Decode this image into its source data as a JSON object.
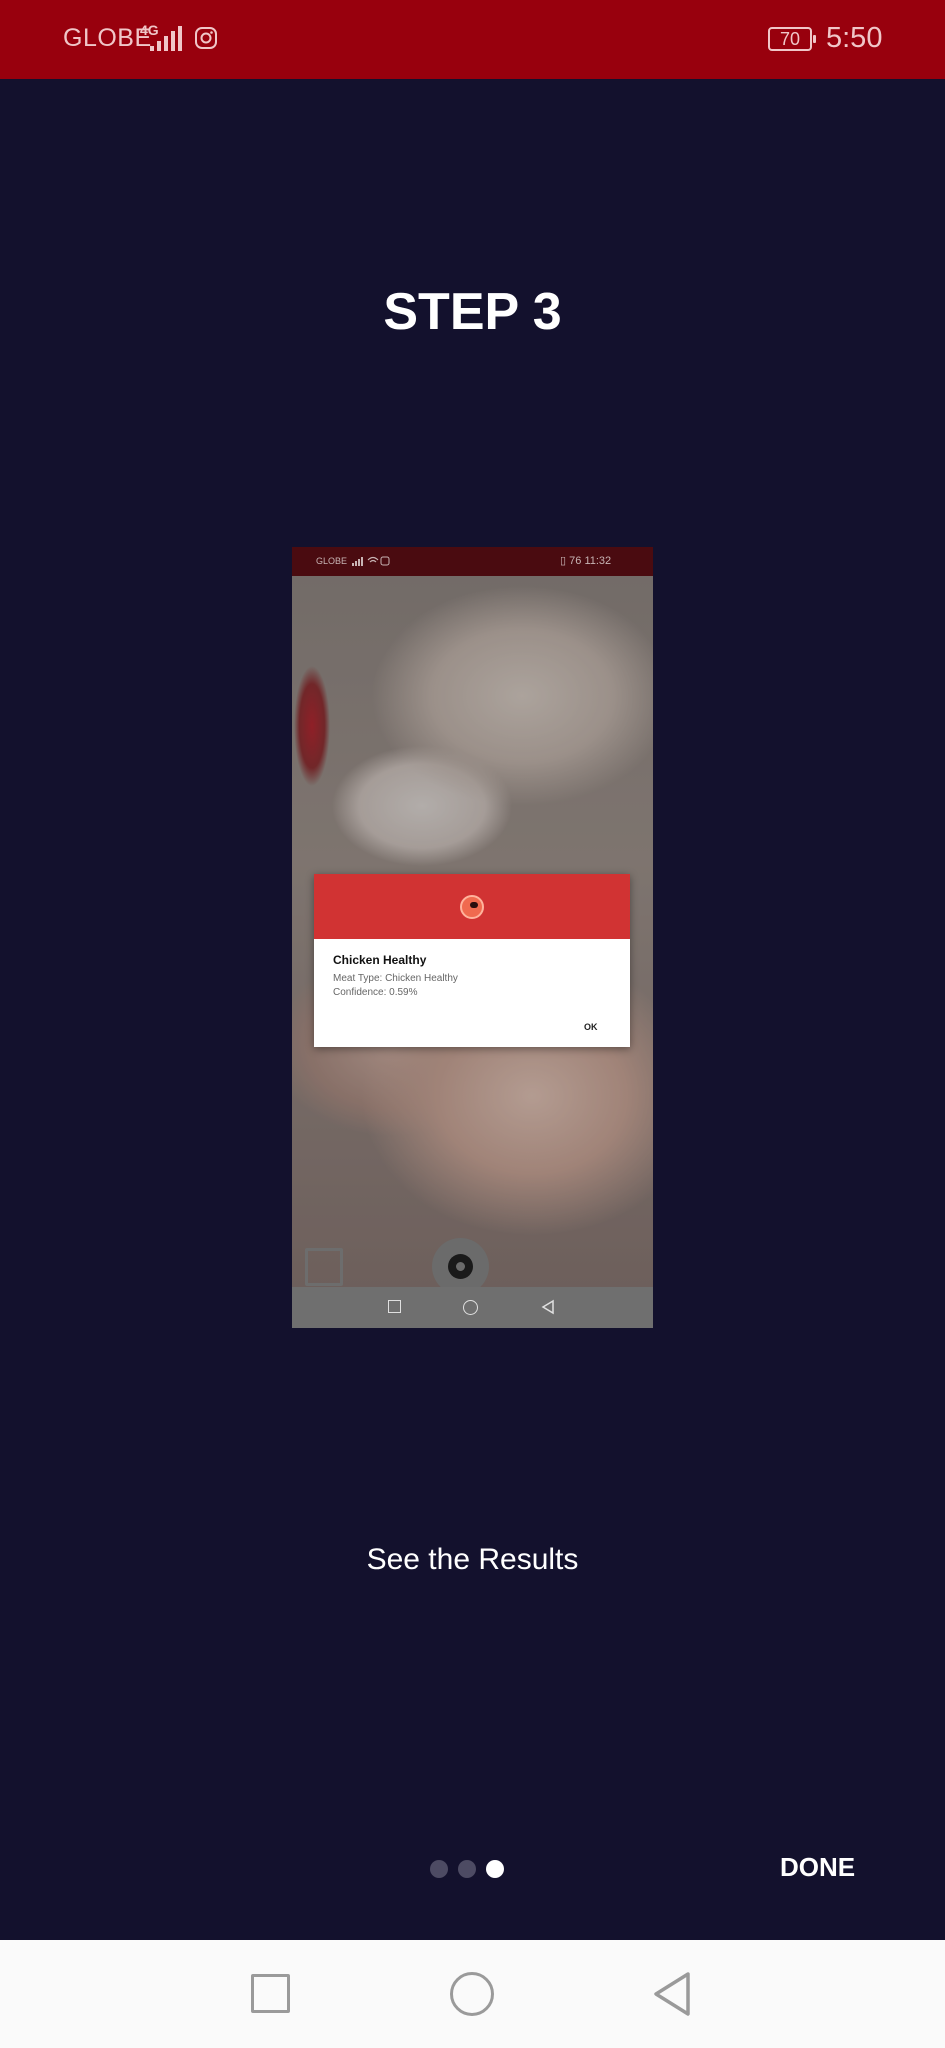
{
  "status_bar": {
    "carrier": "GLOBE",
    "network_type": "4G",
    "battery": "70",
    "time": "5:50"
  },
  "title": "STEP 3",
  "screenshot_preview": {
    "status_bar": {
      "carrier": "GLOBE",
      "battery": "76",
      "time": "11:32"
    },
    "dialog": {
      "title": "Chicken Healthy",
      "meat_type_line": "Meat Type: Chicken Healthy",
      "confidence_line": "Confidence: 0.59%",
      "ok_label": "OK"
    }
  },
  "caption": "See the Results",
  "pager": {
    "total_pages": 3,
    "current_page": 3
  },
  "done_label": "DONE"
}
